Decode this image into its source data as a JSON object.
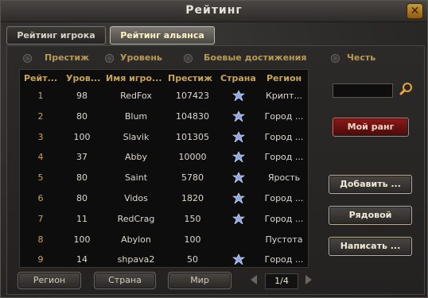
{
  "window": {
    "title": "Рейтинг",
    "close": "✕"
  },
  "tabs": [
    "Рейтинг игрока",
    "Рейтинг альянса"
  ],
  "sort_options": [
    "Престиж",
    "Уровень",
    "Боевые достижения",
    "Честь"
  ],
  "table": {
    "headers": [
      "Рейт...",
      "Уров...",
      "Имя игро...",
      "Престиж",
      "Страна",
      "Регион"
    ],
    "rows": [
      {
        "rank": "1",
        "level": "98",
        "name": "RedFox",
        "prestige": "107423",
        "flag": true,
        "region": "Крипт..."
      },
      {
        "rank": "2",
        "level": "80",
        "name": "Blum",
        "prestige": "104830",
        "flag": true,
        "region": "Город ..."
      },
      {
        "rank": "3",
        "level": "100",
        "name": "Slavik",
        "prestige": "101305",
        "flag": true,
        "region": "Город ..."
      },
      {
        "rank": "4",
        "level": "37",
        "name": "Abby",
        "prestige": "10000",
        "flag": true,
        "region": "Город ..."
      },
      {
        "rank": "5",
        "level": "80",
        "name": "Saint",
        "prestige": "5780",
        "flag": true,
        "region": "Ярость"
      },
      {
        "rank": "6",
        "level": "80",
        "name": "Vidos",
        "prestige": "1820",
        "flag": true,
        "region": "Город ..."
      },
      {
        "rank": "7",
        "level": "11",
        "name": "RedCrag",
        "prestige": "150",
        "flag": true,
        "region": "Город ..."
      },
      {
        "rank": "8",
        "level": "100",
        "name": "Abylon",
        "prestige": "100",
        "flag": false,
        "region": "Пустота"
      },
      {
        "rank": "9",
        "level": "14",
        "name": "shpava2",
        "prestige": "50",
        "flag": true,
        "region": "Город ..."
      }
    ]
  },
  "search": {
    "value": ""
  },
  "buttons": {
    "my_rank": "Мой ранг",
    "add": "Добавить ...",
    "member": "Рядовой",
    "write": "Написать ..."
  },
  "filters": [
    "Регион",
    "Страна",
    "Мир"
  ],
  "pagination": {
    "label": "1/4"
  },
  "colors": {
    "accent_gold": "#c8a55a",
    "my_rank_red": "#8a1a1a",
    "flag_blue": "#8fa8e8"
  }
}
